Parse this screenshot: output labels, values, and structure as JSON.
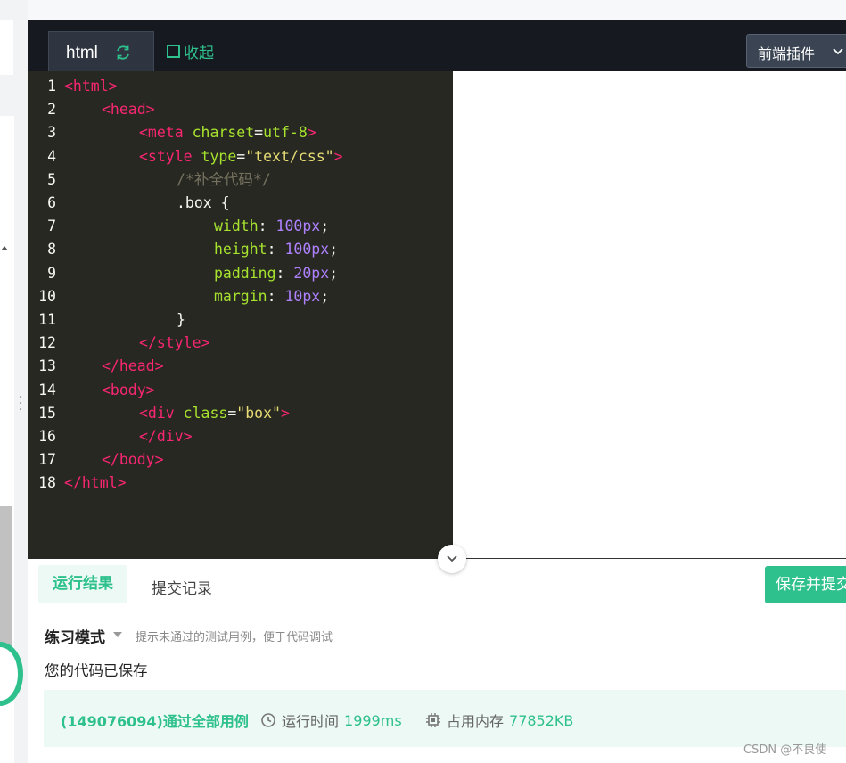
{
  "editor": {
    "tab_label": "html",
    "collapse_label": "收起",
    "plugin_label": "前端插件"
  },
  "code_lines": [
    {
      "n": "1",
      "parts": [
        [
          "tag",
          "<html>"
        ]
      ],
      "indent": 0
    },
    {
      "n": "2",
      "parts": [
        [
          "tag",
          "<head>"
        ]
      ],
      "indent": 4
    },
    {
      "n": "3",
      "parts": [
        [
          "tag",
          "<meta "
        ],
        [
          "attr",
          "charset"
        ],
        [
          "txt",
          "="
        ],
        [
          "attr",
          "utf-8"
        ],
        [
          "tag",
          ">"
        ]
      ],
      "indent": 8
    },
    {
      "n": "4",
      "parts": [
        [
          "tag",
          "<style "
        ],
        [
          "attr",
          "type"
        ],
        [
          "txt",
          "="
        ],
        [
          "str",
          "\"text/css\""
        ],
        [
          "tag",
          ">"
        ]
      ],
      "indent": 8
    },
    {
      "n": "5",
      "parts": [
        [
          "com",
          "/*补全代码*/"
        ]
      ],
      "indent": 12
    },
    {
      "n": "6",
      "parts": [
        [
          "txt",
          ".box {"
        ]
      ],
      "indent": 12
    },
    {
      "n": "7",
      "parts": [
        [
          "attr",
          "width"
        ],
        [
          "txt",
          ": "
        ],
        [
          "num",
          "100px"
        ],
        [
          "txt",
          ";"
        ]
      ],
      "indent": 16
    },
    {
      "n": "8",
      "parts": [
        [
          "attr",
          "height"
        ],
        [
          "txt",
          ": "
        ],
        [
          "num",
          "100px"
        ],
        [
          "txt",
          ";"
        ]
      ],
      "indent": 16
    },
    {
      "n": "9",
      "parts": [
        [
          "attr",
          "padding"
        ],
        [
          "txt",
          ": "
        ],
        [
          "num",
          "20px"
        ],
        [
          "txt",
          ";"
        ]
      ],
      "indent": 16
    },
    {
      "n": "10",
      "parts": [
        [
          "attr",
          "margin"
        ],
        [
          "txt",
          ": "
        ],
        [
          "num",
          "10px"
        ],
        [
          "txt",
          ";"
        ]
      ],
      "indent": 16
    },
    {
      "n": "11",
      "parts": [
        [
          "txt",
          "}"
        ]
      ],
      "indent": 12
    },
    {
      "n": "12",
      "parts": [
        [
          "tag",
          "</style>"
        ]
      ],
      "indent": 8
    },
    {
      "n": "13",
      "parts": [
        [
          "tag",
          "</head>"
        ]
      ],
      "indent": 4
    },
    {
      "n": "14",
      "parts": [
        [
          "tag",
          "<body>"
        ]
      ],
      "indent": 4
    },
    {
      "n": "15",
      "parts": [
        [
          "tag",
          "<div "
        ],
        [
          "attr",
          "class"
        ],
        [
          "txt",
          "="
        ],
        [
          "str",
          "\"box\""
        ],
        [
          "tag",
          ">"
        ]
      ],
      "indent": 8
    },
    {
      "n": "16",
      "parts": [
        [
          "tag",
          "</div>"
        ]
      ],
      "indent": 8
    },
    {
      "n": "17",
      "parts": [
        [
          "tag",
          "</body>"
        ]
      ],
      "indent": 4
    },
    {
      "n": "18",
      "parts": [
        [
          "tag",
          "</html>"
        ]
      ],
      "indent": 0
    }
  ],
  "result": {
    "tab_run": "运行结果",
    "tab_history": "提交记录",
    "save_submit": "保存并提交",
    "mode_label": "练习模式",
    "mode_hint": "提示未通过的测试用例，便于代码调试",
    "saved_msg": "您的代码已保存",
    "pass_text": "(149076094)通过全部用例",
    "runtime_label": "运行时间",
    "runtime_value": "1999ms",
    "memory_label": "占用内存",
    "memory_value": "77852KB"
  },
  "watermark": "CSDN @不良使",
  "colors": {
    "accent": "#2ec08d",
    "editor_bg": "#272822",
    "tag": "#f92672",
    "attr": "#a6e22e",
    "string": "#e6db74",
    "comment": "#75715e",
    "number": "#ae81ff"
  },
  "icons": {
    "refresh": "refresh-icon",
    "collapse": "collapse-square-icon",
    "chevron": "chevron-down-icon",
    "clock": "clock-icon",
    "chip": "chip-icon"
  }
}
